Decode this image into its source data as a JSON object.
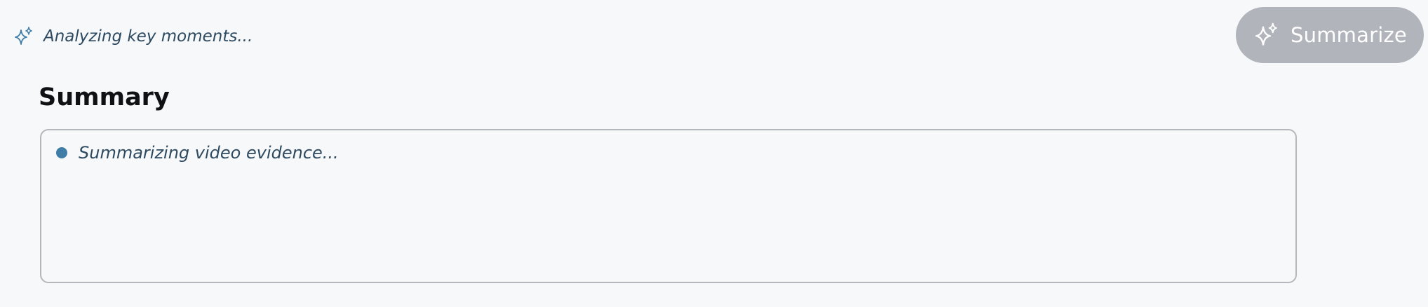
{
  "status": {
    "icon": "sparkles-icon",
    "text": "Analyzing key moments..."
  },
  "summarize_button": {
    "icon": "sparkles-icon",
    "label": "Summarize",
    "state": "disabled"
  },
  "summary": {
    "title": "Summary",
    "bullet_text": "Summarizing video evidence..."
  },
  "colors": {
    "background": "#f7f8fa",
    "accent": "#3f7da7",
    "status_text": "#2e4a60",
    "button_disabled": "#b1b5bb",
    "border": "#b4b7bc"
  }
}
